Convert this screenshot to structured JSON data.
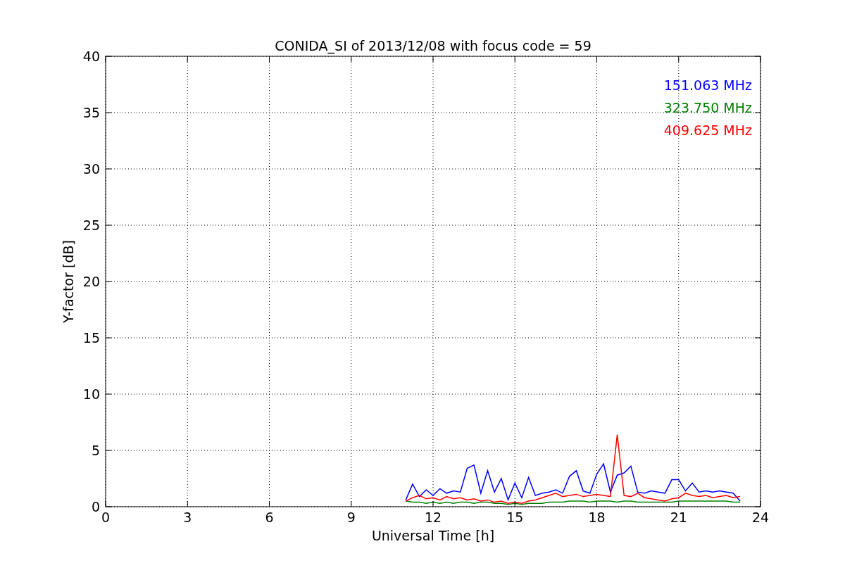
{
  "figure": {
    "chart_data": {
      "type": "line",
      "title": "CONIDA_SI of 2013/12/08 with focus code = 59",
      "xlabel": "Universal Time [h]",
      "ylabel": "Y-factor [dB]",
      "xlim": [
        0,
        24
      ],
      "ylim": [
        0,
        40
      ],
      "xticks": [
        0,
        3,
        6,
        9,
        12,
        15,
        18,
        21,
        24
      ],
      "yticks": [
        0,
        5,
        10,
        15,
        20,
        25,
        30,
        35,
        40
      ],
      "grid": true,
      "x": [
        11.0,
        11.25,
        11.5,
        11.75,
        12.0,
        12.25,
        12.5,
        12.75,
        13.0,
        13.25,
        13.5,
        13.75,
        14.0,
        14.25,
        14.5,
        14.75,
        15.0,
        15.25,
        15.5,
        15.75,
        16.0,
        16.25,
        16.5,
        16.75,
        17.0,
        17.25,
        17.5,
        17.75,
        18.0,
        18.25,
        18.5,
        18.75,
        19.0,
        19.25,
        19.5,
        19.75,
        20.0,
        20.25,
        20.5,
        20.75,
        21.0,
        21.25,
        21.5,
        21.75,
        22.0,
        22.25,
        22.5,
        22.75,
        23.0,
        23.25
      ],
      "series": [
        {
          "name": "151.063 MHz",
          "color": "#0000ff",
          "values": [
            0.6,
            2.0,
            0.9,
            1.5,
            1.0,
            1.6,
            1.2,
            1.4,
            1.3,
            3.4,
            3.7,
            1.2,
            3.2,
            1.3,
            2.5,
            0.6,
            2.1,
            0.8,
            2.6,
            1.0,
            1.2,
            1.3,
            1.5,
            1.2,
            2.7,
            3.2,
            1.4,
            1.2,
            2.9,
            3.8,
            1.3,
            2.8,
            3.0,
            3.6,
            1.3,
            1.2,
            1.4,
            1.3,
            1.2,
            2.4,
            2.4,
            1.4,
            2.1,
            1.3,
            1.4,
            1.3,
            1.4,
            1.3,
            1.2,
            0.5
          ]
        },
        {
          "name": "323.750 MHz",
          "color": "#008000",
          "values": [
            0.5,
            0.4,
            0.4,
            0.3,
            0.4,
            0.3,
            0.4,
            0.3,
            0.4,
            0.4,
            0.3,
            0.4,
            0.4,
            0.3,
            0.3,
            0.2,
            0.3,
            0.2,
            0.3,
            0.3,
            0.3,
            0.4,
            0.4,
            0.4,
            0.5,
            0.5,
            0.5,
            0.4,
            0.5,
            0.5,
            0.5,
            0.4,
            0.5,
            0.5,
            0.4,
            0.4,
            0.4,
            0.4,
            0.4,
            0.4,
            0.5,
            0.5,
            0.5,
            0.5,
            0.5,
            0.5,
            0.5,
            0.5,
            0.4,
            0.4
          ]
        },
        {
          "name": "409.625 MHz",
          "color": "#ff0000",
          "values": [
            0.5,
            0.8,
            1.0,
            0.7,
            0.8,
            0.6,
            0.9,
            0.7,
            0.8,
            0.6,
            0.7,
            0.5,
            0.6,
            0.4,
            0.5,
            0.3,
            0.4,
            0.3,
            0.5,
            0.6,
            0.8,
            1.0,
            1.2,
            0.9,
            1.0,
            1.1,
            0.9,
            1.0,
            1.1,
            1.0,
            0.9,
            6.4,
            1.0,
            0.9,
            1.2,
            0.8,
            0.7,
            0.6,
            0.5,
            0.7,
            0.8,
            1.2,
            1.0,
            0.9,
            1.0,
            0.8,
            0.9,
            1.0,
            0.8,
            0.9
          ]
        }
      ]
    }
  }
}
